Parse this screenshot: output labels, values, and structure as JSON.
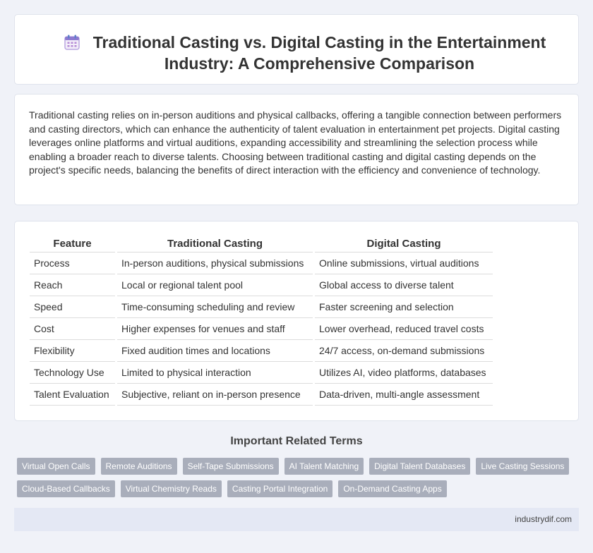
{
  "header": {
    "title": "Traditional Casting vs. Digital Casting in the Entertainment Industry: A Comprehensive Comparison",
    "icon": "calendar-icon"
  },
  "intro": {
    "text": "Traditional casting relies on in-person auditions and physical callbacks, offering a tangible connection between performers and casting directors, which can enhance the authenticity of talent evaluation in entertainment pet projects. Digital casting leverages online platforms and virtual auditions, expanding accessibility and streamlining the selection process while enabling a broader reach to diverse talents. Choosing between traditional casting and digital casting depends on the project's specific needs, balancing the benefits of direct interaction with the efficiency and convenience of technology."
  },
  "table": {
    "headers": [
      "Feature",
      "Traditional Casting",
      "Digital Casting"
    ],
    "rows": [
      [
        "Process",
        "In-person auditions, physical submissions",
        "Online submissions, virtual auditions"
      ],
      [
        "Reach",
        "Local or regional talent pool",
        "Global access to diverse talent"
      ],
      [
        "Speed",
        "Time-consuming scheduling and review",
        "Faster screening and selection"
      ],
      [
        "Cost",
        "Higher expenses for venues and staff",
        "Lower overhead, reduced travel costs"
      ],
      [
        "Flexibility",
        "Fixed audition times and locations",
        "24/7 access, on-demand submissions"
      ],
      [
        "Technology Use",
        "Limited to physical interaction",
        "Utilizes AI, video platforms, databases"
      ],
      [
        "Talent Evaluation",
        "Subjective, reliant on in-person presence",
        "Data-driven, multi-angle assessment"
      ]
    ]
  },
  "terms": {
    "heading": "Important Related Terms",
    "row1": [
      "Virtual Open Calls",
      "Remote Auditions",
      "Self-Tape Submissions",
      "AI Talent Matching",
      "Digital Talent Databases",
      "Live Casting Sessions"
    ],
    "row2": [
      "Cloud-Based Callbacks",
      "Virtual Chemistry Reads",
      "Casting Portal Integration",
      "On-Demand Casting Apps"
    ]
  },
  "footer": {
    "site": "industrydif.com"
  },
  "colors": {
    "background": "#f0f2f8",
    "tag": "#a9aebb",
    "footer": "#e4e8f4"
  }
}
